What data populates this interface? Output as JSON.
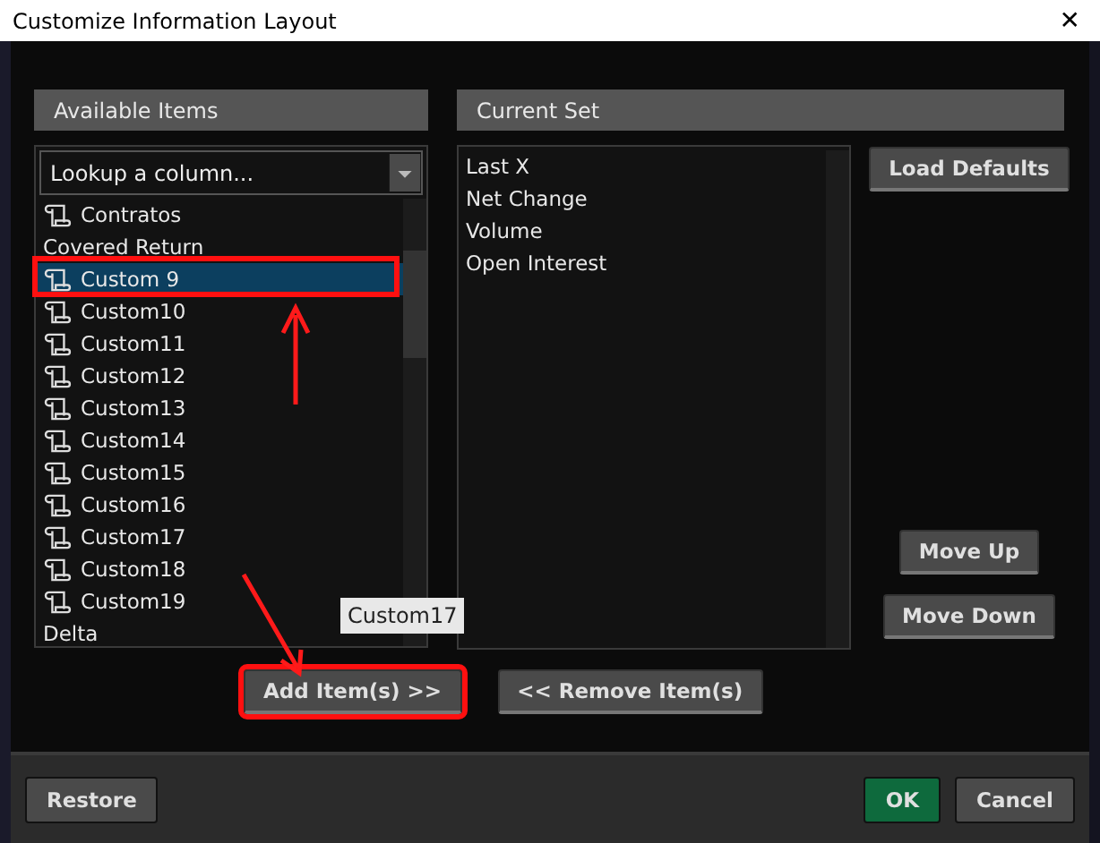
{
  "window": {
    "title": "Customize Information Layout",
    "close": "✕"
  },
  "available": {
    "header": "Available Items",
    "lookup": {
      "placeholder": "Lookup a column..."
    },
    "items": [
      {
        "label": "Contratos",
        "icon": true,
        "selected": false
      },
      {
        "label": "Covered Return",
        "icon": false,
        "selected": false
      },
      {
        "label": "Custom 9",
        "icon": true,
        "selected": true
      },
      {
        "label": "Custom10",
        "icon": true,
        "selected": false
      },
      {
        "label": "Custom11",
        "icon": true,
        "selected": false
      },
      {
        "label": "Custom12",
        "icon": true,
        "selected": false
      },
      {
        "label": "Custom13",
        "icon": true,
        "selected": false
      },
      {
        "label": "Custom14",
        "icon": true,
        "selected": false
      },
      {
        "label": "Custom15",
        "icon": true,
        "selected": false
      },
      {
        "label": "Custom16",
        "icon": true,
        "selected": false
      },
      {
        "label": "Custom17",
        "icon": true,
        "selected": false
      },
      {
        "label": "Custom18",
        "icon": true,
        "selected": false
      },
      {
        "label": "Custom19",
        "icon": true,
        "selected": false
      },
      {
        "label": "Delta",
        "icon": false,
        "selected": false
      }
    ],
    "tooltip": "Custom17"
  },
  "current": {
    "header": "Current Set",
    "items": [
      "Last X",
      "Net Change",
      "Volume",
      "Open Interest"
    ]
  },
  "side_buttons": {
    "load_defaults": "Load Defaults",
    "move_up": "Move Up",
    "move_down": "Move Down"
  },
  "add_button": "Add Item(s) >>",
  "remove_button": "<< Remove Item(s)",
  "footer": {
    "restore": "Restore",
    "ok": "OK",
    "cancel": "Cancel"
  }
}
